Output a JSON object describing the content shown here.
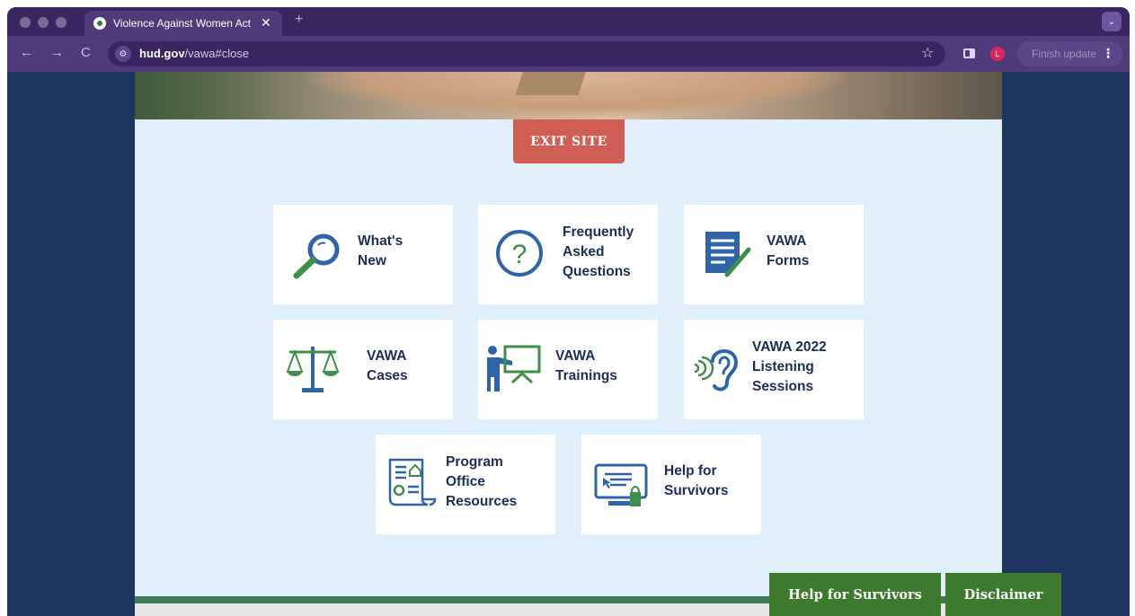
{
  "browser": {
    "tab_title": "Violence Against Women Act",
    "tab_close": "✕",
    "new_tab": "+",
    "tab_menu": "⌄",
    "back": "←",
    "forward": "→",
    "reload": "C",
    "url_domain": "hud.gov",
    "url_path": "/vawa#close",
    "bookmark_star": "☆",
    "profile_initial": "L",
    "finish_update": "Finish update",
    "menu_dots": "⋮"
  },
  "page": {
    "exit_site": "EXIT SITE",
    "tiles": [
      {
        "label": "What's\nNew",
        "icon": "magnifier-icon"
      },
      {
        "label": "Frequently\nAsked\nQuestions",
        "icon": "question-circle-icon"
      },
      {
        "label": "VAWA\nForms",
        "icon": "document-pen-icon"
      },
      {
        "label": "VAWA\nCases",
        "icon": "scales-icon"
      },
      {
        "label": "VAWA\nTrainings",
        "icon": "presenter-board-icon"
      },
      {
        "label": "VAWA 2022\nListening\nSessions",
        "icon": "ear-icon"
      },
      {
        "label": "Program\nOffice\nResources",
        "icon": "scroll-document-icon"
      },
      {
        "label": "Help for\nSurvivors",
        "icon": "computer-screen-icon"
      }
    ],
    "bottom_buttons": {
      "help_for_survivors": "Help for Survivors",
      "disclaimer": "Disclaimer"
    }
  },
  "colors": {
    "navy": "#1e3461",
    "light_blue_bg": "#e1effa",
    "exit_red": "#cf5f55",
    "icon_blue": "#2e64a8",
    "icon_green": "#3f8f4a",
    "button_green": "#3e7a2e"
  }
}
